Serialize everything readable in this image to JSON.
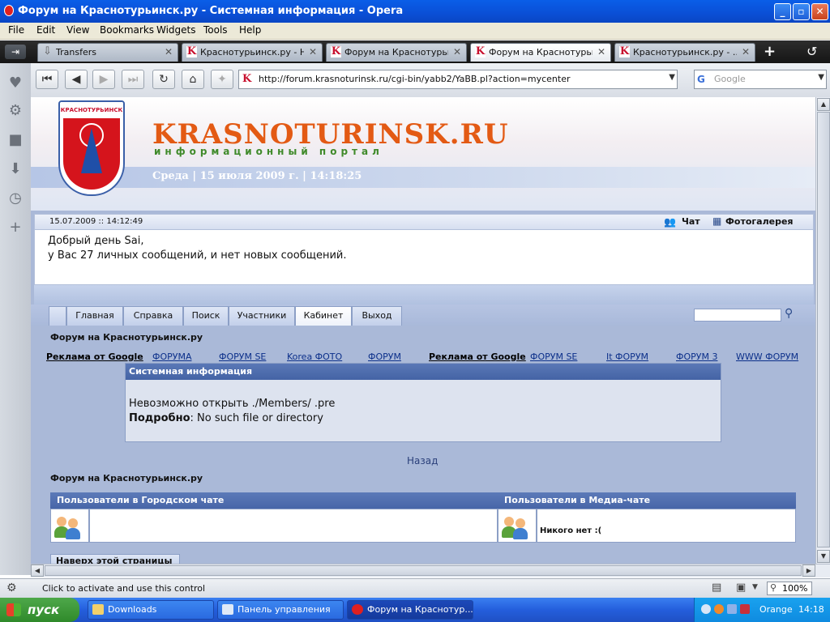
{
  "window": {
    "title": "Форум на Краснотурьинск.ру - Системная информация - Opera"
  },
  "menu": [
    "File",
    "Edit",
    "View",
    "Bookmarks",
    "Widgets",
    "Tools",
    "Help"
  ],
  "tabs": [
    {
      "label": "Transfers",
      "active": false
    },
    {
      "label": "Краснотурьинск.ру - Н...",
      "active": false
    },
    {
      "label": "Форум на Краснотурьи...",
      "active": false
    },
    {
      "label": "Форум на Краснотурьи...",
      "active": true
    },
    {
      "label": "Краснотурьинск.ру - ...",
      "active": false
    }
  ],
  "address": {
    "url": "http://forum.krasnoturinsk.ru/cgi-bin/yabb2/YaBB.pl?action=mycenter",
    "search_placeholder": "Google"
  },
  "site": {
    "crest_text": "КРАСНОТУРЬИНСК",
    "logo_title": "KRASNOTURINSK.RU",
    "logo_subtitle": "информационный портал",
    "date_line": "Среда | 15 июля 2009 г. | 14:18:25"
  },
  "forum": {
    "login_time": "15.07.2009 :: 14:12:49",
    "chat_label": "Чат",
    "gallery_label": "Фотогалерея",
    "greeting_line1": "Добрый день Sai,",
    "greeting_line2": "у Вас 27 личных сообщений, и нет новых сообщений.",
    "nav": [
      "Главная",
      "Справка",
      "Поиск",
      "Участники",
      "Кабинет",
      "Выход"
    ],
    "nav_active": "Кабинет",
    "forum_name": "Форум на Краснотурьинск.ру",
    "ads": [
      "Реклама от Google",
      "ФОРУМА",
      "ФОРУМ SE",
      "Korea ФОТО",
      "ФОРУМ",
      "Реклама от Google",
      "ФОРУМ SE",
      "It ФОРУМ",
      "ФОРУМ 3",
      "WWW ФОРУМ"
    ],
    "sysinfo_title": "Системная информация",
    "error_line": "Невозможно открыть ./Members/  .pre",
    "detail_label": "Подробно",
    "detail_value": ": No such file or directory",
    "back_label": "Назад",
    "forum_name_bottom": "Форум на Краснотурьинск.ру",
    "city_chat_header": "Пользователи в Городском чате",
    "media_chat_header": "Пользователи в Медиа-чате",
    "media_chat_status": "Никого нет :(",
    "top_link": "Наверх этой страницы"
  },
  "status": {
    "text": "Click to activate and use this control",
    "zoom": "100%"
  },
  "taskbar": {
    "start": "пуск",
    "tasks": [
      {
        "label": "Downloads",
        "active": false
      },
      {
        "label": "Панель управления",
        "active": false
      },
      {
        "label": "Форум на Краснотур...",
        "active": true
      }
    ],
    "lang": "Orange",
    "clock": "14:18"
  }
}
